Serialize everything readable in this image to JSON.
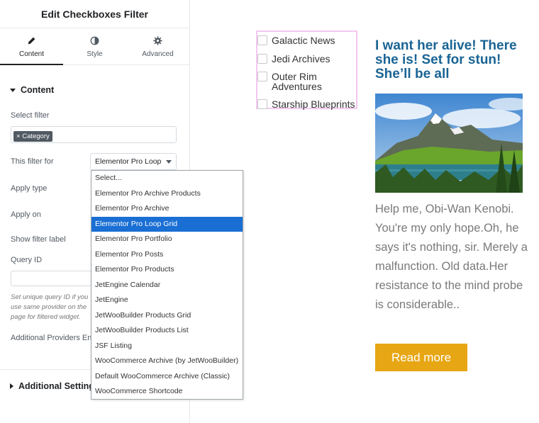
{
  "panel": {
    "title": "Edit Checkboxes Filter",
    "tabs": [
      {
        "label": "Content",
        "icon": "pencil-icon"
      },
      {
        "label": "Style",
        "icon": "half-circle-icon"
      },
      {
        "label": "Advanced",
        "icon": "gear-icon"
      }
    ],
    "section_content": "Content",
    "select_filter_label": "Select filter",
    "select_filter_tag": "Category",
    "filter_for_label": "This filter for",
    "filter_for_value": "Elementor Pro Loop",
    "apply_type_label": "Apply type",
    "apply_on_label": "Apply on",
    "show_filter_label": "Show filter label",
    "query_id_label": "Query ID",
    "hint_text": "Set unique query ID if you use same provider on the page for filtered widget.",
    "additional_providers_label": "Additional Providers En",
    "section_additional": "Additional Settings"
  },
  "dropdown": {
    "options": [
      "Select...",
      "Elementor Pro Archive Products",
      "Elementor Pro Archive",
      "Elementor Pro Loop Grid",
      "Elementor Pro Portfolio",
      "Elementor Pro Posts",
      "Elementor Pro Products",
      "JetEngine Calendar",
      "JetEngine",
      "JetWooBuilder Products Grid",
      "JetWooBuilder Products List",
      "JSF Listing",
      "WooCommerce Archive (by JetWooBuilder)",
      "Default WooCommerce Archive (Classic)",
      "WooCommerce Shortcode"
    ],
    "selected": "Elementor Pro Loop Grid"
  },
  "filter_checkboxes": [
    "Galactic News",
    "Jedi Archives",
    "Outer Rim Adventures",
    "Starship Blueprints"
  ],
  "card": {
    "title": "I want her alive! There she is! Set for stun! She’ll be all",
    "text": "Help me, Obi-Wan Kenobi. You're my only hope.Oh, he says it's nothing, sir. Merely a malfunction. Old data.Her resistance to the mind probe is considerable..",
    "button": "Read more"
  },
  "colors": {
    "accent_blue": "#1a6494",
    "button_yellow": "#e7a613",
    "selected_option": "#1a6fd4",
    "filter_border": "#f2c8f0"
  }
}
